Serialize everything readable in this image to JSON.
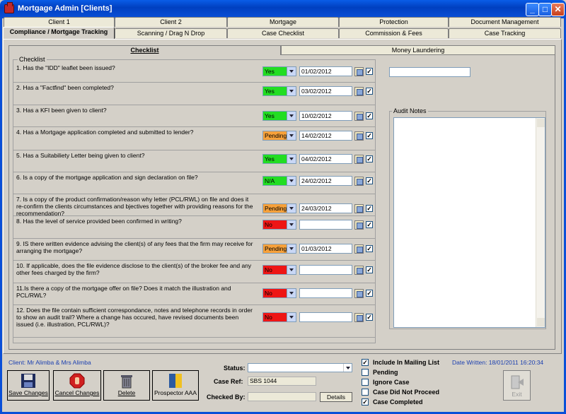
{
  "window": {
    "title": "Mortgage Admin [Clients]"
  },
  "tabs_row1": [
    "Client 1",
    "Client 2",
    "Mortgage",
    "Protection",
    "Document Management"
  ],
  "tabs_row2": [
    "Compliance / Mortgage Tracking",
    "Scanning / Drag N Drop",
    "Case Checklist",
    "Commission & Fees",
    "Case Tracking"
  ],
  "inner_tabs": [
    "Checklist",
    "Money Laundering"
  ],
  "checklist": {
    "group_label": "Checklist",
    "items": [
      {
        "q": "1. Has the \"IDD\" leaflet been issued?",
        "status": "Yes",
        "date": "01/02/2012",
        "checked": true
      },
      {
        "q": "2. Has a \"Factfind\" been completed?",
        "status": "Yes",
        "date": "03/02/2012",
        "checked": true
      },
      {
        "q": "3. Has a KFI been given to client?",
        "status": "Yes",
        "date": "10/02/2012",
        "checked": true
      },
      {
        "q": "4. Has a Mortgage application completed and submitted to lender?",
        "status": "Pending",
        "date": "14/02/2012",
        "checked": true
      },
      {
        "q": "5. Has a Suitabiliety Letter being given to client?",
        "status": "Yes",
        "date": "04/02/2012",
        "checked": true
      },
      {
        "q": "6. Is a copy of the mortgage application  and sign declaration on file?",
        "status": "N/A",
        "date": "24/02/2012",
        "checked": true
      },
      {
        "q": "7. Is a copy of the product confirmation/reason why letter (PCL/RWL) on file and does it re-confirm the clients circumstances and bjectives together with providing reasons for the recommendation?",
        "status": "Pending",
        "date": "24/03/2012",
        "checked": true
      },
      {
        "q": "8. Has the level of service provided been confirmed in writing?",
        "status": "No",
        "date": "",
        "checked": true
      },
      {
        "q": "9. IS there written evidence advising the client(s) of any fees that the firm may receive for arranging the mortgage?",
        "status": "Pending",
        "date": "01/03/2012",
        "checked": true
      },
      {
        "q": "10. If applicable, does the file evidence disclose to the client(s) of the broker fee and any other fees charged by the firm?",
        "status": "No",
        "date": "",
        "checked": true
      },
      {
        "q": "11.Is there a copy of the mortgage offer on file? Does it match the illustration and PCL/RWL?",
        "status": "No",
        "date": "",
        "checked": true
      },
      {
        "q": "12. Does the file contain sufficient correspondance, notes and telephone records in order to show an audit trail? Where a change has occured, have revised documents been issued (i.e. illustration, PCL/RWL)?",
        "status": "No",
        "date": "",
        "checked": true
      }
    ],
    "status_colors": {
      "Yes": "#22dd22",
      "Pending": "#f7a13a",
      "No": "#ee1515",
      "N/A": "#22dd22"
    }
  },
  "audit_notes_label": "Audit Notes",
  "client_text": "Client: Mr Alimba & Mrs Alimba",
  "buttons": {
    "save": "Save Changes",
    "cancel": "Cancel Changes",
    "delete": "Delete",
    "prospector": "Prospector AAA",
    "details": "Details",
    "exit": "Exit"
  },
  "form": {
    "status_label": "Status:",
    "status_value": "",
    "caseref_label": "Case Ref:",
    "caseref_value": "SBS 1044",
    "checkedby_label": "Checked By:",
    "checkedby_value": ""
  },
  "options": [
    {
      "label": "Include In Mailing List",
      "checked": true
    },
    {
      "label": "Pending",
      "checked": false
    },
    {
      "label": "Ignore Case",
      "checked": false
    },
    {
      "label": "Case Did Not Proceed",
      "checked": false
    },
    {
      "label": "Case Completed",
      "checked": true
    }
  ],
  "date_written": "Date Written: 18/01/2011 16:20:34"
}
